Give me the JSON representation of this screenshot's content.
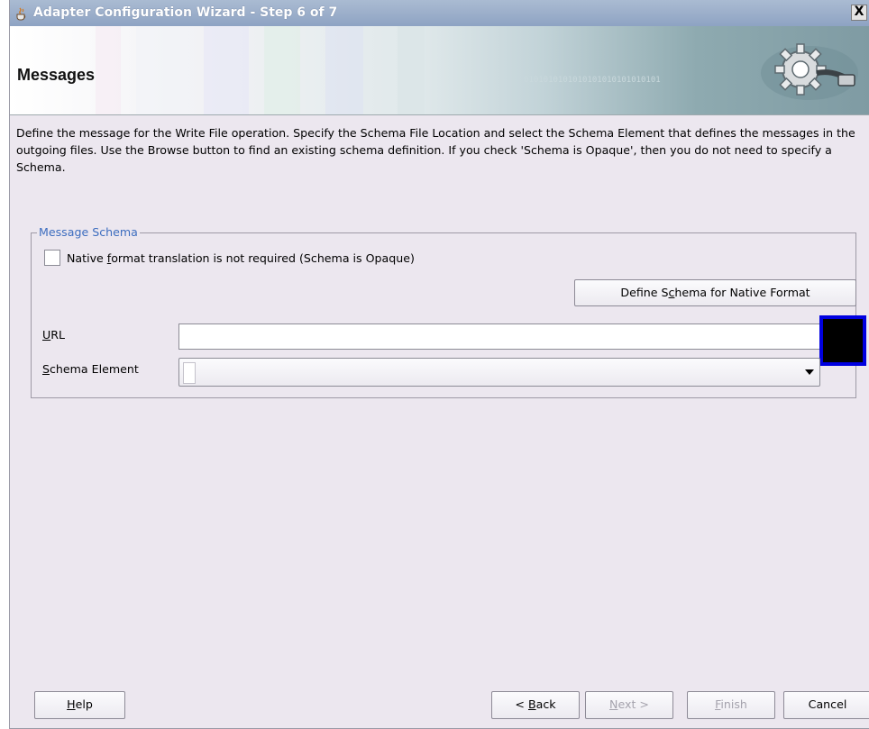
{
  "window": {
    "title": "Adapter Configuration Wizard - Step 6 of 7",
    "close_label": "X"
  },
  "header": {
    "page_title": "Messages",
    "binary_text": "0101010101010101010101010101"
  },
  "description": {
    "text": "Define the message for the Write File operation.  Specify the Schema File Location and select the Schema Element that defines the messages in the outgoing files. Use the Browse button to find an existing schema definition. If you check 'Schema is Opaque', then you do not need to specify a Schema."
  },
  "message_schema": {
    "legend": "Message Schema",
    "opaque_checkbox": {
      "label_pre": "Native ",
      "label_mnemonic": "f",
      "label_post": "ormat translation is not required (Schema is Opaque)",
      "checked": false
    },
    "define_button": {
      "pre": "Define S",
      "mnemonic": "c",
      "post": "hema for Native Format"
    },
    "url": {
      "label_mnemonic": "U",
      "label_post": "RL",
      "value": ""
    },
    "schema_element": {
      "label_mnemonic": "S",
      "label_post": "chema Element",
      "selected": ""
    }
  },
  "footer": {
    "help": {
      "mnemonic": "H",
      "post": "elp"
    },
    "back": {
      "pre": "< ",
      "mnemonic": "B",
      "post": "ack"
    },
    "next": {
      "mnemonic": "N",
      "post": "ext >"
    },
    "finish": {
      "mnemonic": "F",
      "post": "inish"
    },
    "cancel": "Cancel"
  },
  "colors": {
    "dialog_bg": "#ece7ef",
    "legend_text": "#3d6dbf",
    "highlight_border": "#0000e0"
  }
}
